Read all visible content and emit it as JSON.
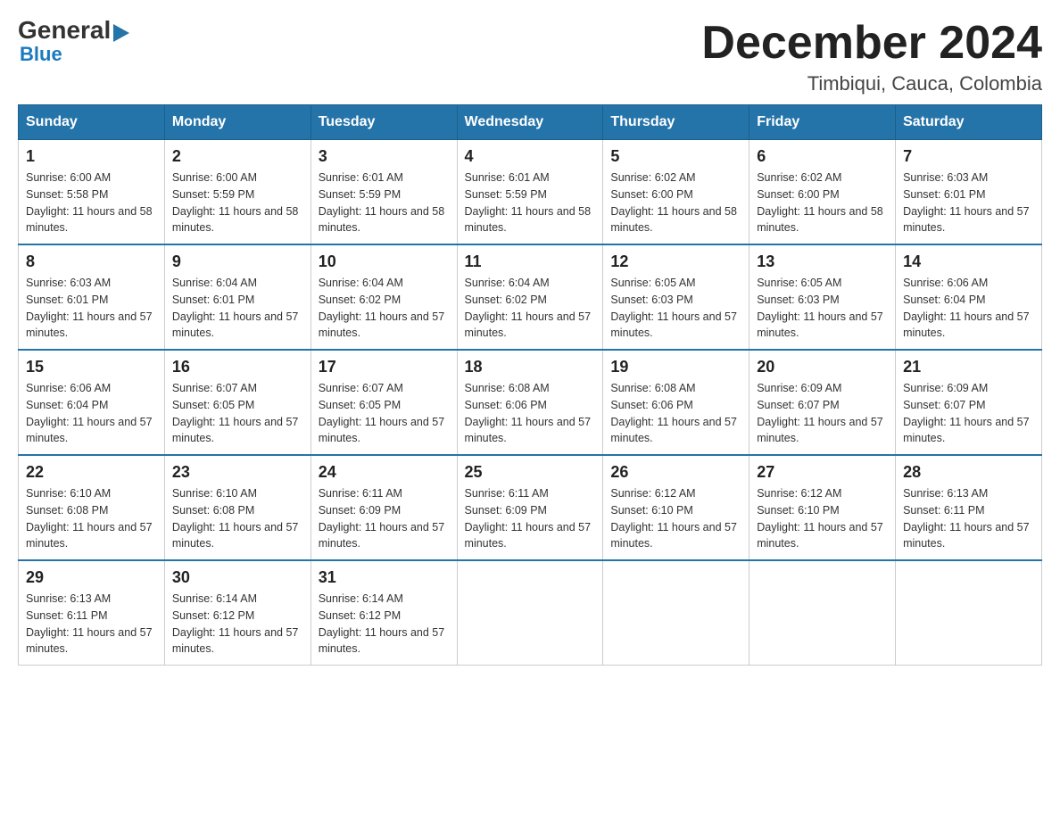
{
  "logo": {
    "text_general": "General",
    "arrow": "▶",
    "text_blue": "Blue"
  },
  "header": {
    "month_year": "December 2024",
    "location": "Timbiqui, Cauca, Colombia"
  },
  "weekdays": [
    "Sunday",
    "Monday",
    "Tuesday",
    "Wednesday",
    "Thursday",
    "Friday",
    "Saturday"
  ],
  "weeks": [
    [
      {
        "day": "1",
        "sunrise": "6:00 AM",
        "sunset": "5:58 PM",
        "daylight": "11 hours and 58 minutes."
      },
      {
        "day": "2",
        "sunrise": "6:00 AM",
        "sunset": "5:59 PM",
        "daylight": "11 hours and 58 minutes."
      },
      {
        "day": "3",
        "sunrise": "6:01 AM",
        "sunset": "5:59 PM",
        "daylight": "11 hours and 58 minutes."
      },
      {
        "day": "4",
        "sunrise": "6:01 AM",
        "sunset": "5:59 PM",
        "daylight": "11 hours and 58 minutes."
      },
      {
        "day": "5",
        "sunrise": "6:02 AM",
        "sunset": "6:00 PM",
        "daylight": "11 hours and 58 minutes."
      },
      {
        "day": "6",
        "sunrise": "6:02 AM",
        "sunset": "6:00 PM",
        "daylight": "11 hours and 58 minutes."
      },
      {
        "day": "7",
        "sunrise": "6:03 AM",
        "sunset": "6:01 PM",
        "daylight": "11 hours and 57 minutes."
      }
    ],
    [
      {
        "day": "8",
        "sunrise": "6:03 AM",
        "sunset": "6:01 PM",
        "daylight": "11 hours and 57 minutes."
      },
      {
        "day": "9",
        "sunrise": "6:04 AM",
        "sunset": "6:01 PM",
        "daylight": "11 hours and 57 minutes."
      },
      {
        "day": "10",
        "sunrise": "6:04 AM",
        "sunset": "6:02 PM",
        "daylight": "11 hours and 57 minutes."
      },
      {
        "day": "11",
        "sunrise": "6:04 AM",
        "sunset": "6:02 PM",
        "daylight": "11 hours and 57 minutes."
      },
      {
        "day": "12",
        "sunrise": "6:05 AM",
        "sunset": "6:03 PM",
        "daylight": "11 hours and 57 minutes."
      },
      {
        "day": "13",
        "sunrise": "6:05 AM",
        "sunset": "6:03 PM",
        "daylight": "11 hours and 57 minutes."
      },
      {
        "day": "14",
        "sunrise": "6:06 AM",
        "sunset": "6:04 PM",
        "daylight": "11 hours and 57 minutes."
      }
    ],
    [
      {
        "day": "15",
        "sunrise": "6:06 AM",
        "sunset": "6:04 PM",
        "daylight": "11 hours and 57 minutes."
      },
      {
        "day": "16",
        "sunrise": "6:07 AM",
        "sunset": "6:05 PM",
        "daylight": "11 hours and 57 minutes."
      },
      {
        "day": "17",
        "sunrise": "6:07 AM",
        "sunset": "6:05 PM",
        "daylight": "11 hours and 57 minutes."
      },
      {
        "day": "18",
        "sunrise": "6:08 AM",
        "sunset": "6:06 PM",
        "daylight": "11 hours and 57 minutes."
      },
      {
        "day": "19",
        "sunrise": "6:08 AM",
        "sunset": "6:06 PM",
        "daylight": "11 hours and 57 minutes."
      },
      {
        "day": "20",
        "sunrise": "6:09 AM",
        "sunset": "6:07 PM",
        "daylight": "11 hours and 57 minutes."
      },
      {
        "day": "21",
        "sunrise": "6:09 AM",
        "sunset": "6:07 PM",
        "daylight": "11 hours and 57 minutes."
      }
    ],
    [
      {
        "day": "22",
        "sunrise": "6:10 AM",
        "sunset": "6:08 PM",
        "daylight": "11 hours and 57 minutes."
      },
      {
        "day": "23",
        "sunrise": "6:10 AM",
        "sunset": "6:08 PM",
        "daylight": "11 hours and 57 minutes."
      },
      {
        "day": "24",
        "sunrise": "6:11 AM",
        "sunset": "6:09 PM",
        "daylight": "11 hours and 57 minutes."
      },
      {
        "day": "25",
        "sunrise": "6:11 AM",
        "sunset": "6:09 PM",
        "daylight": "11 hours and 57 minutes."
      },
      {
        "day": "26",
        "sunrise": "6:12 AM",
        "sunset": "6:10 PM",
        "daylight": "11 hours and 57 minutes."
      },
      {
        "day": "27",
        "sunrise": "6:12 AM",
        "sunset": "6:10 PM",
        "daylight": "11 hours and 57 minutes."
      },
      {
        "day": "28",
        "sunrise": "6:13 AM",
        "sunset": "6:11 PM",
        "daylight": "11 hours and 57 minutes."
      }
    ],
    [
      {
        "day": "29",
        "sunrise": "6:13 AM",
        "sunset": "6:11 PM",
        "daylight": "11 hours and 57 minutes."
      },
      {
        "day": "30",
        "sunrise": "6:14 AM",
        "sunset": "6:12 PM",
        "daylight": "11 hours and 57 minutes."
      },
      {
        "day": "31",
        "sunrise": "6:14 AM",
        "sunset": "6:12 PM",
        "daylight": "11 hours and 57 minutes."
      },
      null,
      null,
      null,
      null
    ]
  ]
}
